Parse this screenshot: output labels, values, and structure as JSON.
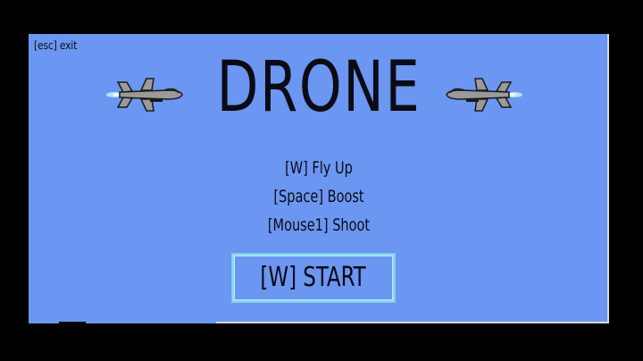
{
  "game": {
    "exit_hint": "[esc] exit",
    "title": "DRONE",
    "controls": [
      "[W] Fly Up",
      "[Space] Boost",
      "[Mouse1] Shoot"
    ],
    "start_label": "[W] START"
  },
  "colors": {
    "background": "#6b96f1",
    "text": "#0b0b14",
    "button_border": "#8fd8f5",
    "drone_body": "#9a9a9a",
    "thruster_glow": "#b8ecff"
  },
  "icons": {
    "left": "drone-icon",
    "right": "drone-icon"
  }
}
